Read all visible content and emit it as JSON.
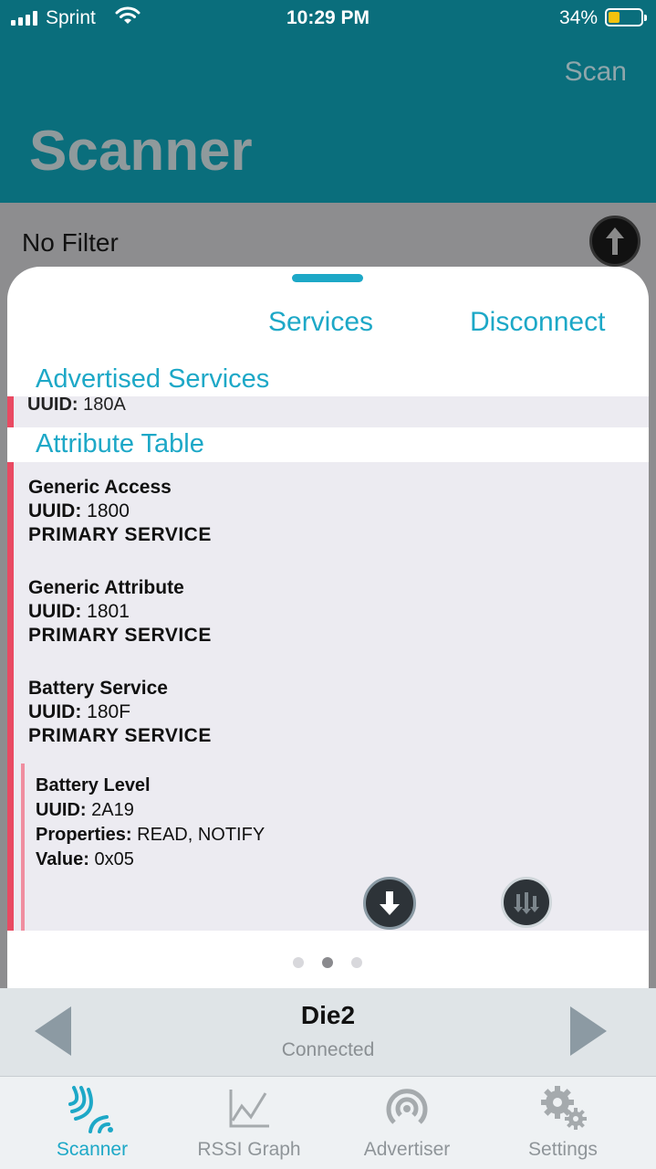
{
  "status_bar": {
    "carrier": "Sprint",
    "time": "10:29 PM",
    "battery_percent": "34%",
    "battery_level": 0.34
  },
  "header": {
    "title": "Scanner",
    "scan_label": "Scan"
  },
  "filter": {
    "label": "No Filter",
    "sort_icon": "up-arrow-icon"
  },
  "sheet": {
    "tabs": {
      "services": "Services",
      "disconnect": "Disconnect"
    },
    "advertised": {
      "title": "Advertised Services",
      "uuid_label": "UUID:",
      "uuid": "180A"
    },
    "attribute_table": {
      "title": "Attribute Table",
      "services": [
        {
          "name": "Generic Access",
          "uuid_label": "UUID:",
          "uuid": "1800",
          "kind": "PRIMARY SERVICE"
        },
        {
          "name": "Generic Attribute",
          "uuid_label": "UUID:",
          "uuid": "1801",
          "kind": "PRIMARY SERVICE"
        },
        {
          "name": "Battery Service",
          "uuid_label": "UUID:",
          "uuid": "180F",
          "kind": "PRIMARY SERVICE"
        }
      ],
      "characteristic": {
        "name": "Battery Level",
        "uuid_label": "UUID:",
        "uuid": "2A19",
        "properties_label": "Properties:",
        "properties": "READ, NOTIFY",
        "value_label": "Value:",
        "value": "0x05"
      }
    },
    "page_dots": {
      "count": 3,
      "active": 2
    }
  },
  "device": {
    "name": "Die2",
    "state": "Connected"
  },
  "tabbar": {
    "items": [
      {
        "label": "Scanner",
        "icon": "scanner-icon",
        "active": true
      },
      {
        "label": "RSSI Graph",
        "icon": "rssi-graph-icon",
        "active": false
      },
      {
        "label": "Advertiser",
        "icon": "advertiser-icon",
        "active": false
      },
      {
        "label": "Settings",
        "icon": "settings-gears-icon",
        "active": false
      }
    ]
  },
  "colors": {
    "header": "#0a6e7c",
    "accent": "#1da8c7",
    "service_bar": "#e94a62",
    "characteristic_bar": "#f08ea0"
  }
}
